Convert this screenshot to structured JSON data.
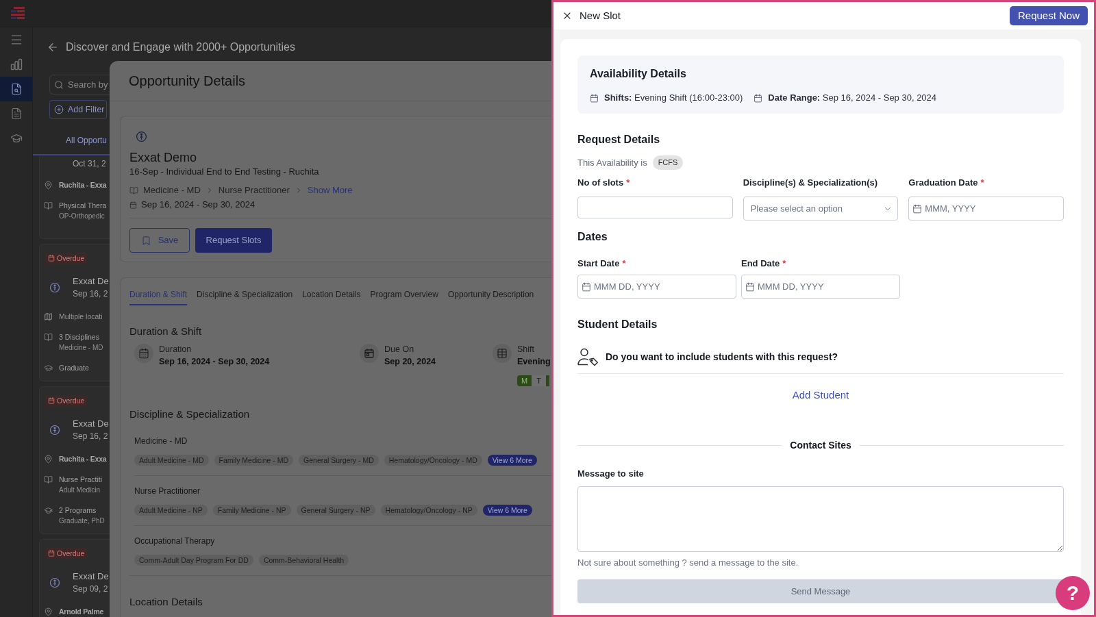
{
  "nav": {
    "items": [
      {
        "selected": false
      },
      {
        "selected": true
      },
      {
        "selected": false
      },
      {
        "selected": false
      }
    ]
  },
  "page": {
    "title": "Discover and Engage with 2000+ Opportunities",
    "search": {
      "placeholder": "Search by"
    },
    "filter_button": "Add Filter",
    "tabs": [
      {
        "label": "All Opportu",
        "selected": true
      }
    ],
    "cards": [
      {
        "date": "Oct 31, 2",
        "rows": [
          {
            "kind": "location",
            "text": "Ruchita - Exxa"
          },
          {
            "kind": "discipline",
            "text": "Physical Thera",
            "detail": "OP-Orthopedic"
          }
        ]
      },
      {
        "status": "Overdue",
        "title": "Exxat De",
        "date": "Sep 16, 2",
        "rows": [
          {
            "kind": "locations",
            "text": "Multiple locati"
          },
          {
            "kind": "discipline",
            "text": "3 Disciplines",
            "detail": "Medicine - MD"
          },
          {
            "kind": "program",
            "text": "Graduate"
          }
        ]
      },
      {
        "status": "Overdue",
        "title": "Exxat De",
        "date": "Sep 16, 2",
        "rows": [
          {
            "kind": "location",
            "text": "Ruchita - Exxa"
          },
          {
            "kind": "discipline",
            "text": "Nurse Practiti",
            "detail": "Adult Medicin"
          },
          {
            "kind": "program",
            "text": "2 Programs",
            "detail": "Graduate, PhD"
          }
        ]
      },
      {
        "status": "Overdue",
        "title": "Exxat De",
        "date": "Sep 09, 2",
        "rows": [
          {
            "kind": "location",
            "text": "Arnold Palme"
          }
        ]
      }
    ]
  },
  "opportunity": {
    "title": "Opportunity Details",
    "org": "Exxat Demo",
    "subtitle": "16-Sep - Individual End to End Testing - Ruchita",
    "breadcrumb": [
      "Medicine - MD",
      "Nurse Practitioner"
    ],
    "show_more": "Show More",
    "date_range": "Sep 16, 2024 - Sep 30, 2024",
    "save_button": "Save",
    "request_button": "Request Slots",
    "tabs": [
      {
        "label": "Duration & Shift",
        "selected": true
      },
      {
        "label": "Discipline & Specialization",
        "selected": false
      },
      {
        "label": "Location Details",
        "selected": false
      },
      {
        "label": "Program Overview",
        "selected": false
      },
      {
        "label": "Opportunity Description",
        "selected": false
      }
    ],
    "duration_shift": {
      "heading": "Duration & Shift",
      "items": [
        {
          "label": "Duration",
          "value": "Sep 16, 2024 - Sep 30, 2024"
        },
        {
          "label": "Due On",
          "value": "Sep 20, 2024"
        },
        {
          "label": "Shift",
          "value": "Evening",
          "days": [
            {
              "label": "M",
              "on": true
            },
            {
              "label": "T",
              "on": false
            },
            {
              "on": true
            }
          ]
        }
      ]
    },
    "disciplines": {
      "heading": "Discipline & Specialization",
      "groups": [
        {
          "name": "Medicine - MD",
          "tags": [
            "Adult Medicine - MD",
            "Family Medicine - MD",
            "General Surgery - MD",
            "Hematology/Oncology - MD"
          ],
          "more": "View 6 More"
        },
        {
          "name": "Nurse Practitioner",
          "tags": [
            "Adult Medicine - NP",
            "Family Medicine - NP",
            "General Surgery - NP",
            "Hematology/Oncology - NP"
          ],
          "more": "View 6 More"
        },
        {
          "name": "Occupational Therapy",
          "tags": [
            "Comm-Adult Day Program For DD",
            "Comm-Behavioral Health"
          ]
        }
      ]
    },
    "location_heading": "Location Details"
  },
  "new_slot": {
    "title": "New Slot",
    "submit_button": "Request Now",
    "availability": {
      "heading": "Availability Details",
      "items": [
        "**Shifts:** Evening Shift (16:00-23:00)",
        "**Date Range:** Sep 16, 2024 - Sep 30, 2024"
      ]
    },
    "request_details": {
      "heading": "Request Details",
      "note": "This Availability is",
      "badge": "FCFS",
      "fields": [
        {
          "kind": "text",
          "label": "No of slots",
          "required_mark": "*"
        },
        {
          "kind": "select",
          "label": "Discipline(s) & Specialization(s)",
          "placeholder": "Please select an option"
        },
        {
          "kind": "date",
          "label": "Graduation Date",
          "required_mark": "*",
          "placeholder": "MMM, YYYY"
        }
      ]
    },
    "dates": {
      "heading": "Dates",
      "fields": [
        {
          "kind": "date",
          "label": "Start Date",
          "required_mark": "*",
          "placeholder": "MMM DD, YYYY"
        },
        {
          "kind": "date",
          "label": "End Date",
          "required_mark": "*",
          "placeholder": "MMM DD, YYYY"
        }
      ]
    },
    "students": {
      "heading": "Student Details",
      "question": "Do you want to include students with this request?",
      "add_button": "Add Student"
    },
    "contact": {
      "heading": "Contact Sites",
      "message_label": "Message to site",
      "hint": "Not sure about something ? send a message to the site.",
      "send_button": {
        "label": "Send Message",
        "disabled": true
      }
    },
    "help_button": "?"
  }
}
